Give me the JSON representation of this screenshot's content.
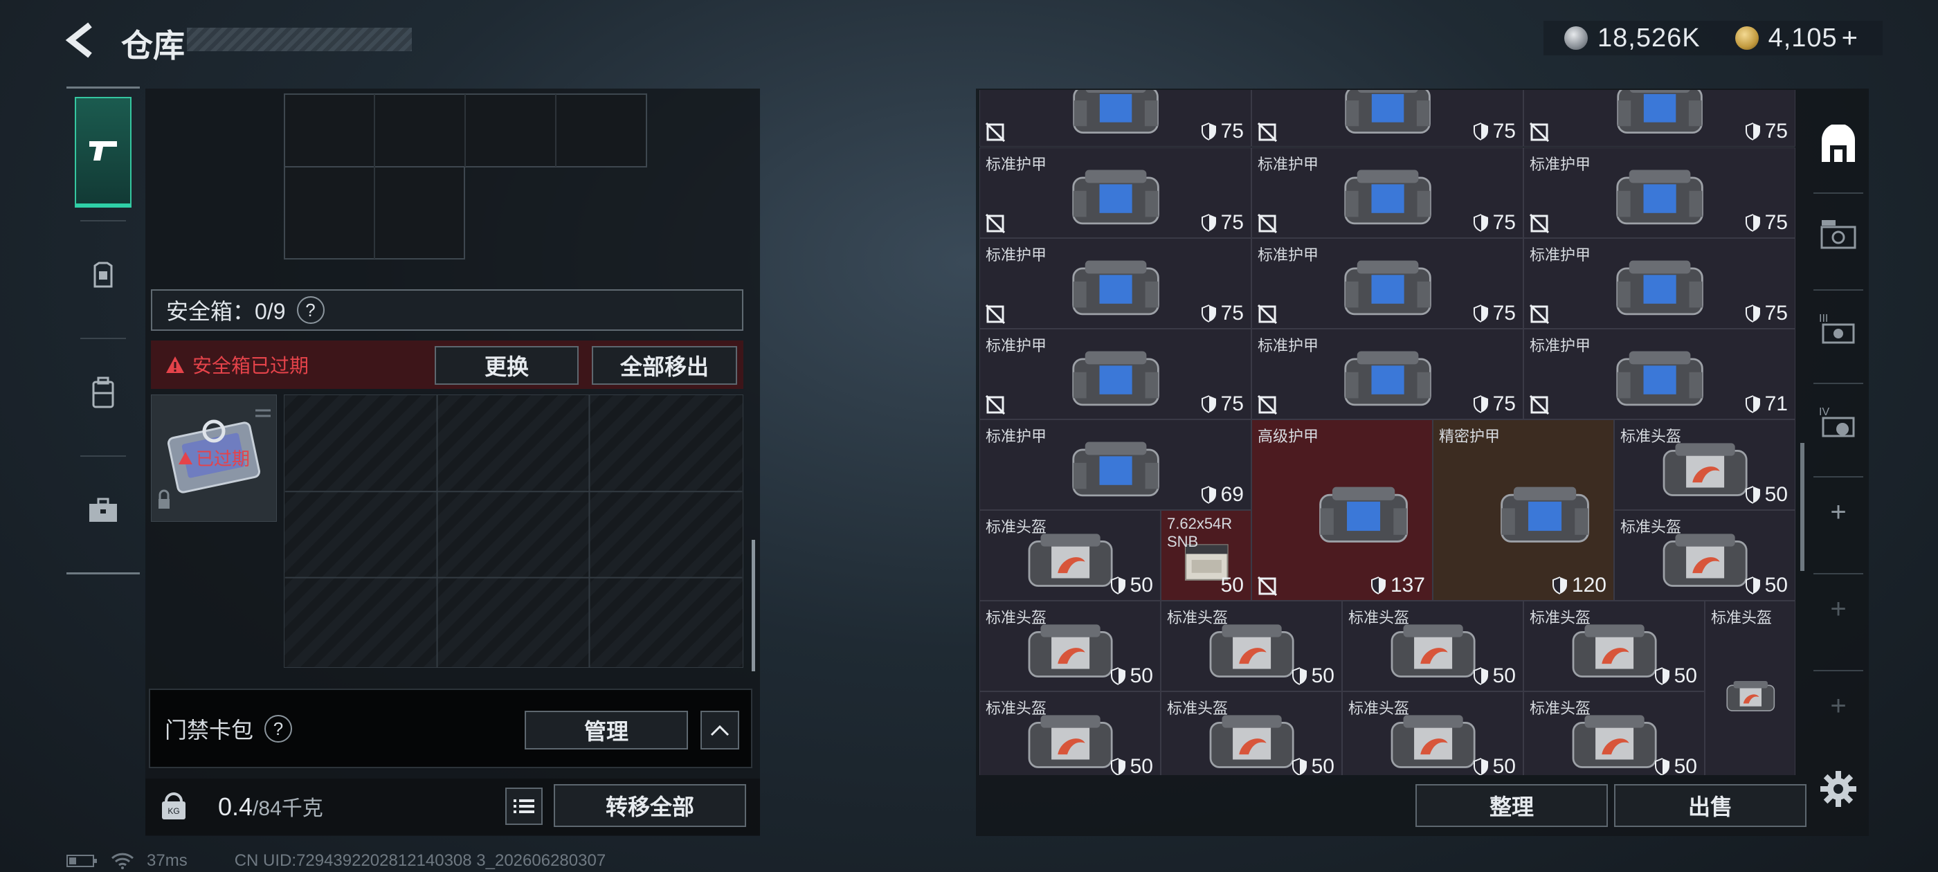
{
  "header": {
    "title": "仓库",
    "currency": [
      {
        "icon": "silver-coin-icon",
        "value": "18,526K"
      },
      {
        "icon": "gold-coin-icon",
        "value": "4,105"
      }
    ],
    "add_label": "+"
  },
  "left_rail": {
    "tabs": [
      {
        "icon": "pistol-icon",
        "active": true
      },
      {
        "icon": "armor-vest-icon",
        "active": false
      },
      {
        "icon": "backpack-icon",
        "active": false
      },
      {
        "icon": "briefcase-icon",
        "active": false
      }
    ]
  },
  "safe_box": {
    "label": "安全箱：0/9",
    "help": "?",
    "expired_notice": "安全箱已过期",
    "replace_label": "更换",
    "remove_all_label": "全部移出",
    "item_badge": "已过期"
  },
  "card_pack": {
    "label": "门禁卡包",
    "help": "?",
    "manage_label": "管理"
  },
  "footer_left": {
    "weight_current": "0.4",
    "weight_max": "/84千克",
    "transfer_all_label": "转移全部"
  },
  "status_bar": {
    "ping": "37ms",
    "uid": "CN UID:7294392202812140308 3_202606280307"
  },
  "inventory": {
    "rows": [
      [
        {
          "name": "",
          "value": "75"
        },
        {
          "name": "",
          "value": "75"
        },
        {
          "name": "",
          "value": "75"
        }
      ],
      [
        {
          "name": "标准护甲",
          "value": "75"
        },
        {
          "name": "标准护甲",
          "value": "75"
        },
        {
          "name": "标准护甲",
          "value": "75"
        }
      ],
      [
        {
          "name": "标准护甲",
          "value": "75"
        },
        {
          "name": "标准护甲",
          "value": "75"
        },
        {
          "name": "标准护甲",
          "value": "75"
        }
      ],
      [
        {
          "name": "标准护甲",
          "value": "75"
        },
        {
          "name": "标准护甲",
          "value": "75"
        },
        {
          "name": "标准护甲",
          "value": "71"
        }
      ]
    ],
    "row5": [
      {
        "name": "标准护甲",
        "value": "69"
      },
      {
        "name": "高级护甲",
        "value": "137"
      },
      {
        "name": "精密护甲",
        "value": "120"
      },
      {
        "name": "标准头盔",
        "value": "50"
      }
    ],
    "row6": [
      {
        "name": "标准头盔",
        "value": "50"
      },
      {
        "name": "7.62x54R SNB",
        "value": "50"
      },
      {
        "name": "标准头盔",
        "value": "50"
      }
    ],
    "row7": [
      {
        "name": "标准头盔",
        "value": "50"
      },
      {
        "name": "标准头盔",
        "value": "50"
      },
      {
        "name": "标准头盔",
        "value": "50"
      },
      {
        "name": "标准头盔",
        "value": "50"
      },
      {
        "name": "标准头盔",
        "value": ""
      }
    ],
    "row8": [
      {
        "name": "标准头盔",
        "value": "50"
      },
      {
        "name": "标准头盔",
        "value": "50"
      },
      {
        "name": "标准头盔",
        "value": "50"
      },
      {
        "name": "标准头盔",
        "value": "50"
      }
    ],
    "sort_label": "整理",
    "sell_label": "出售"
  },
  "right_rail": {
    "icons": [
      "home-icon",
      "vehicle-storage-icon",
      "storage-iii-icon",
      "storage-iv-icon",
      "add-icon",
      "add-icon",
      "add-icon",
      "settings-icon"
    ]
  },
  "colors": {
    "accent": "#2fd0a7",
    "danger": "#e5434a",
    "panel": "#262530"
  }
}
